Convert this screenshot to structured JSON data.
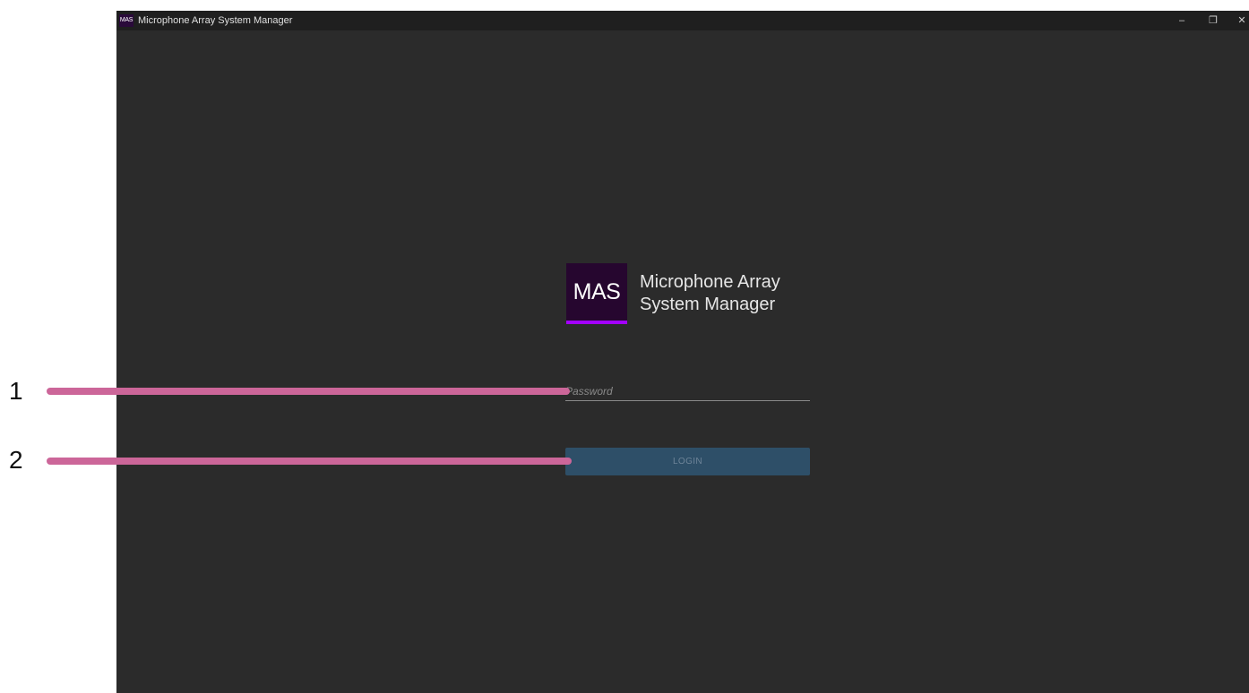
{
  "window": {
    "title": "Microphone Array System Manager",
    "logo_text": "MAS",
    "controls": {
      "minimize": "–",
      "restore": "❐",
      "close": "✕"
    }
  },
  "login": {
    "logo_text": "MAS",
    "app_name_line1": "Microphone Array",
    "app_name_line2": "System Manager",
    "password_placeholder": "Password",
    "password_value": "",
    "login_label": "LOGIN"
  },
  "callouts": [
    {
      "label": "1"
    },
    {
      "label": "2"
    }
  ],
  "colors": {
    "window_bg": "#2b2b2b",
    "titlebar_bg": "#1f1f1f",
    "logo_bg": "#26062f",
    "logo_accent": "#a300ff",
    "button_bg": "#2e4f68",
    "callout_line": "#cc6699"
  }
}
